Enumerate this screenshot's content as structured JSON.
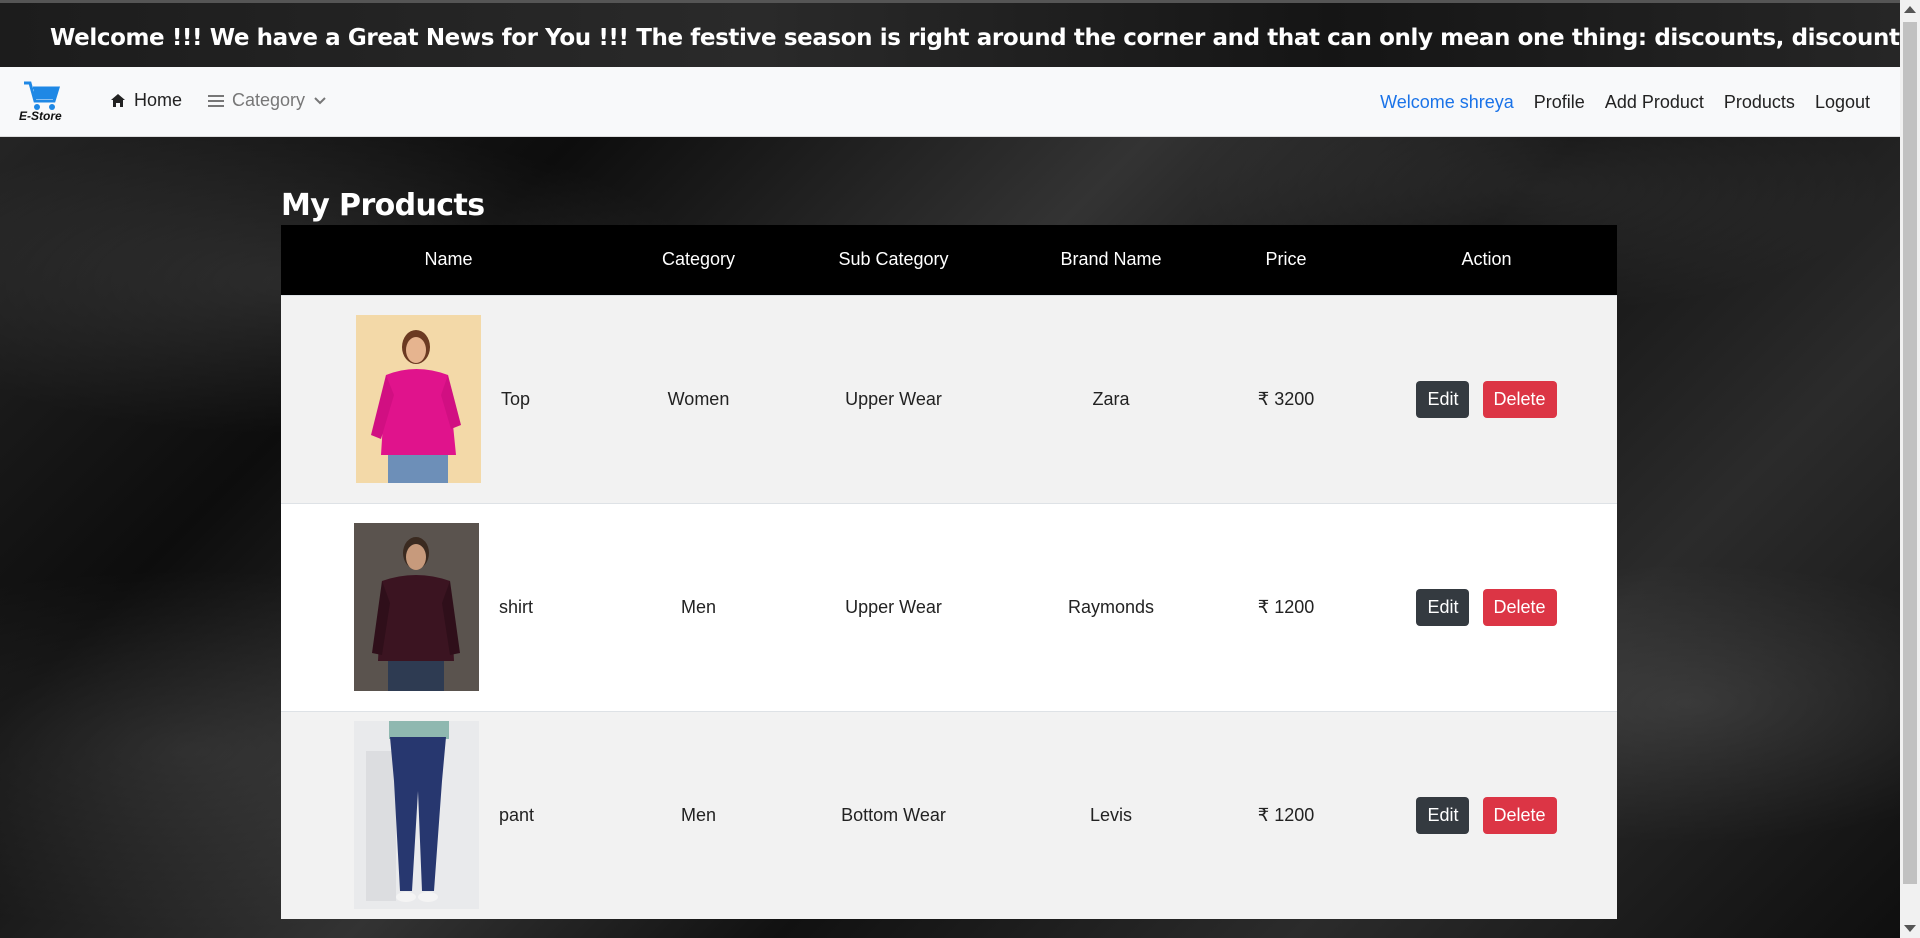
{
  "marquee": {
    "text": "Welcome !!! We have a Great News for You !!! The festive season is right around the corner and that can only mean one thing: discounts, discounts and discounts. Renovate your home, u"
  },
  "navbar": {
    "brand": "E-Store",
    "home": "Home",
    "category": "Category",
    "welcome": "Welcome shreya",
    "profile": "Profile",
    "add_product": "Add Product",
    "products": "Products",
    "logout": "Logout"
  },
  "page": {
    "title": "My Products"
  },
  "table": {
    "headers": [
      "Name",
      "Category",
      "Sub Category",
      "Brand Name",
      "Price",
      "Action"
    ],
    "rows": [
      {
        "name": "Top",
        "category": "Women",
        "sub_category": "Upper Wear",
        "brand": "Zara",
        "price": "₹ 3200",
        "edit": "Edit",
        "delete": "Delete"
      },
      {
        "name": "shirt",
        "category": "Men",
        "sub_category": "Upper Wear",
        "brand": "Raymonds",
        "price": "₹ 1200",
        "edit": "Edit",
        "delete": "Delete"
      },
      {
        "name": "pant",
        "category": "Men",
        "sub_category": "Bottom Wear",
        "brand": "Levis",
        "price": "₹ 1200",
        "edit": "Edit",
        "delete": "Delete"
      }
    ]
  },
  "colors": {
    "accent": "#1a73e8",
    "edit_button": "#343a40",
    "delete_button": "#dc3545",
    "header_bg": "#000000"
  }
}
